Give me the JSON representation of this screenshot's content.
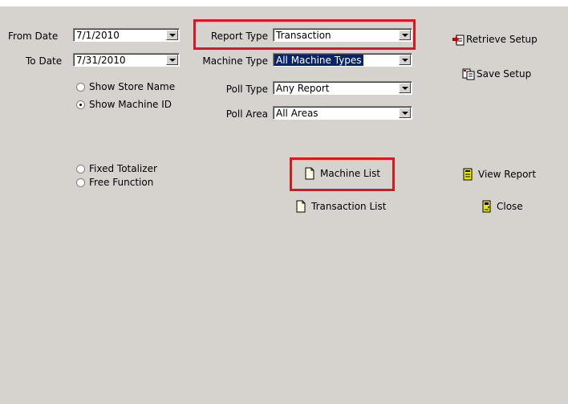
{
  "filters": {
    "from_date_label": "From Date",
    "from_date_value": "7/1/2010",
    "to_date_label": "To Date",
    "to_date_value": "7/31/2010",
    "report_type_label": "Report Type",
    "report_type_value": "Transaction",
    "machine_type_label": "Machine Type",
    "machine_type_value": "All Machine Types",
    "poll_type_label": "Poll Type",
    "poll_type_value": "Any Report",
    "poll_area_label": "Poll Area",
    "poll_area_value": "All Areas"
  },
  "display_options": [
    {
      "label": "Show Store Name",
      "checked": false
    },
    {
      "label": "Show Machine ID",
      "checked": true
    }
  ],
  "totalizer_options": [
    {
      "label": "Fixed Totalizer",
      "checked": false
    },
    {
      "label": "Free Function",
      "checked": false
    }
  ],
  "actions": {
    "retrieve_setup": "Retrieve Setup",
    "save_setup": "Save Setup",
    "machine_list": "Machine List",
    "transaction_list": "Transaction List",
    "view_report": "View Report",
    "close": "Close"
  },
  "highlight_color": "#e0141e",
  "icons": {
    "retrieve_setup": "retrieve-setup-icon",
    "save_setup": "save-setup-icon",
    "machine_list": "document-icon",
    "transaction_list": "document-icon",
    "view_report": "report-icon",
    "close": "close-door-icon"
  }
}
